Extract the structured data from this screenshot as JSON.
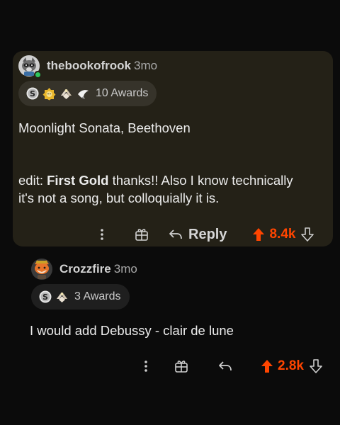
{
  "comment": {
    "username": "thebookofrook",
    "age": "3mo",
    "awards_label": "10 Awards",
    "award_icons": [
      "silver-award-icon",
      "gold-badge-icon",
      "hands-award-icon",
      "wing-award-icon"
    ],
    "text_line1": "Moonlight Sonata, Beethoven",
    "edit_prefix": "edit: ",
    "edit_bold": "First Gold",
    "edit_rest1": " thanks!!  Also I know technically",
    "edit_rest2": "it's not a song, but colloquially it is.",
    "reply_label": "Reply",
    "score": "8.4k",
    "online": true
  },
  "reply": {
    "username": "Crozzfire",
    "age": "3mo",
    "awards_label": "3 Awards",
    "award_icons": [
      "silver-award-icon",
      "hands-award-icon"
    ],
    "text": "I would add Debussy - clair de lune",
    "score": "2.8k"
  },
  "colors": {
    "upvote": "#ff4500",
    "card_bg": "#242117",
    "page_bg": "#0b0b0b",
    "online": "#2ec55c"
  }
}
